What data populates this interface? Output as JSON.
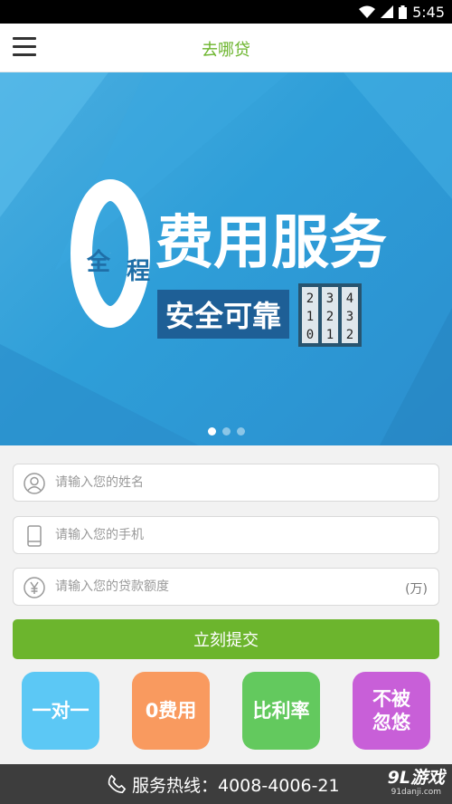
{
  "status": {
    "time": "5:45"
  },
  "app": {
    "title": "去哪贷"
  },
  "banner": {
    "badge_top": "全",
    "badge_side": "程",
    "zero": "0",
    "headline": "费用服务",
    "subline": "安全可靠",
    "lock_digits": [
      "2",
      "1",
      "0",
      "3",
      "2",
      "1",
      "4",
      "3",
      "2"
    ]
  },
  "form": {
    "name_placeholder": "请输入您的姓名",
    "phone_placeholder": "请输入您的手机",
    "amount_placeholder": "请输入您的贷款额度",
    "amount_unit": "(万)",
    "submit_label": "立刻提交"
  },
  "tiles": [
    {
      "label": "一对一",
      "color": "#5cc8f5"
    },
    {
      "label": "0费用",
      "color": "#f99a5f"
    },
    {
      "label": "比利率",
      "color": "#63c95e"
    },
    {
      "label": "不被\n忽悠",
      "color": "#c85fd8"
    }
  ],
  "footer": {
    "hotline": "服务热线：4008-4006-21",
    "watermark_big": "9L游戏",
    "watermark_small": "91danji.com"
  }
}
